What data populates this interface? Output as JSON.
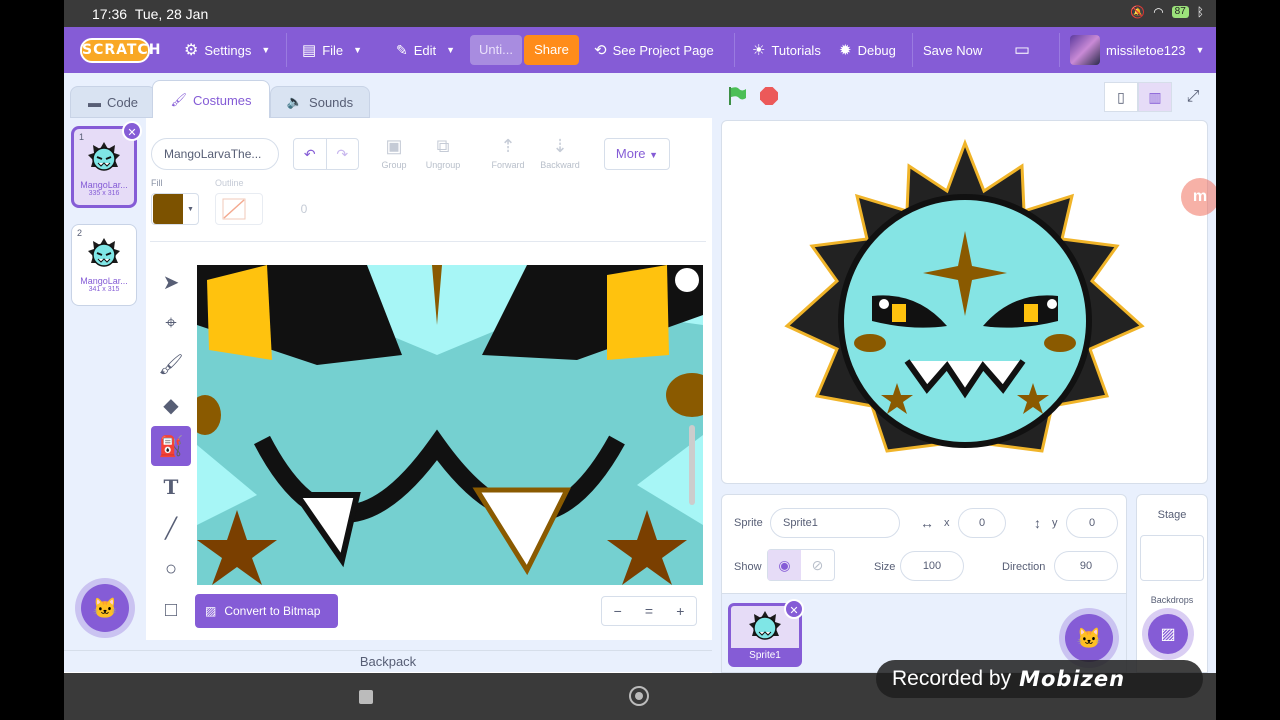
{
  "status_bar": {
    "time": "17:36",
    "date": "Tue, 28 Jan",
    "battery": "87"
  },
  "menu": {
    "logo": "SCRATCH",
    "settings": "Settings",
    "file": "File",
    "edit": "Edit",
    "project_title": "Unti...",
    "share": "Share",
    "see_project_page": "See Project Page",
    "tutorials": "Tutorials",
    "debug": "Debug",
    "save_now": "Save Now",
    "username": "missiletoe123"
  },
  "tabs": {
    "code": "Code",
    "costumes": "Costumes",
    "sounds": "Sounds"
  },
  "costumes": [
    {
      "num": "1",
      "name": "MangoLar...",
      "size": "335 x 316"
    },
    {
      "num": "2",
      "name": "MangoLar...",
      "size": "341 x 315"
    }
  ],
  "paint": {
    "costume_name": "MangoLarvaThe...",
    "group": "Group",
    "ungroup": "Ungroup",
    "forward": "Forward",
    "backward": "Backward",
    "more": "More",
    "fill_label": "Fill",
    "outline_label": "Outline",
    "outline_width": "0",
    "fill_color": "#7c5200",
    "convert_button": "Convert to Bitmap",
    "zoom_out": "−",
    "zoom_reset": "=",
    "zoom_in": "+"
  },
  "backpack": "Backpack",
  "sprite": {
    "label": "Sprite",
    "name": "Sprite1",
    "x_label": "x",
    "x": "0",
    "y_label": "y",
    "y": "0",
    "show_label": "Show",
    "size_label": "Size",
    "size": "100",
    "direction_label": "Direction",
    "direction": "90",
    "thumb_name": "Sprite1"
  },
  "stage_panel": {
    "title": "Stage",
    "backdrops": "Backdrops"
  },
  "overlay": {
    "recorded_by": "Recorded by",
    "brand": "Mobizen",
    "badge": "m"
  },
  "colors": {
    "accent": "#855cd6",
    "share": "#ff8c1a",
    "flag": "#4cbf56",
    "stop": "#ec5959"
  }
}
